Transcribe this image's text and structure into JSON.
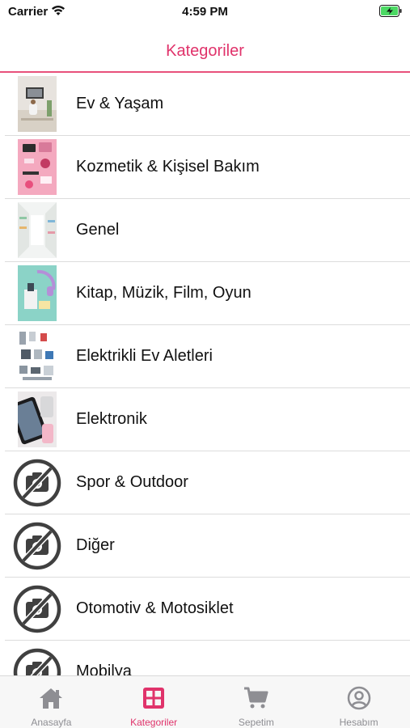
{
  "status_bar": {
    "carrier": "Carrier",
    "time": "4:59 PM"
  },
  "header": {
    "title": "Kategoriler"
  },
  "categories": [
    {
      "label": "Ev & Yaşam",
      "image": "photo-home"
    },
    {
      "label": "Kozmetik & Kişisel Bakım",
      "image": "photo-cosmetics"
    },
    {
      "label": "Genel",
      "image": "photo-general"
    },
    {
      "label": "Kitap, Müzik, Film, Oyun",
      "image": "photo-books"
    },
    {
      "label": "Elektrikli Ev Aletleri",
      "image": "photo-appliances"
    },
    {
      "label": "Elektronik",
      "image": "photo-electronics"
    },
    {
      "label": "Spor & Outdoor",
      "image": "no-image-icon"
    },
    {
      "label": "Diğer",
      "image": "no-image-icon"
    },
    {
      "label": "Otomotiv & Motosiklet",
      "image": "no-image-icon"
    },
    {
      "label": "Mobilya",
      "image": "no-image-icon"
    }
  ],
  "tabs": [
    {
      "label": "Anasayfa",
      "icon": "home-icon",
      "active": false
    },
    {
      "label": "Kategoriler",
      "icon": "grid-icon",
      "active": true
    },
    {
      "label": "Sepetim",
      "icon": "cart-icon",
      "active": false
    },
    {
      "label": "Hesabım",
      "icon": "account-icon",
      "active": false
    }
  ],
  "colors": {
    "accent": "#e0336b",
    "divider": "#e8517b",
    "inactive": "#8e8e93"
  }
}
